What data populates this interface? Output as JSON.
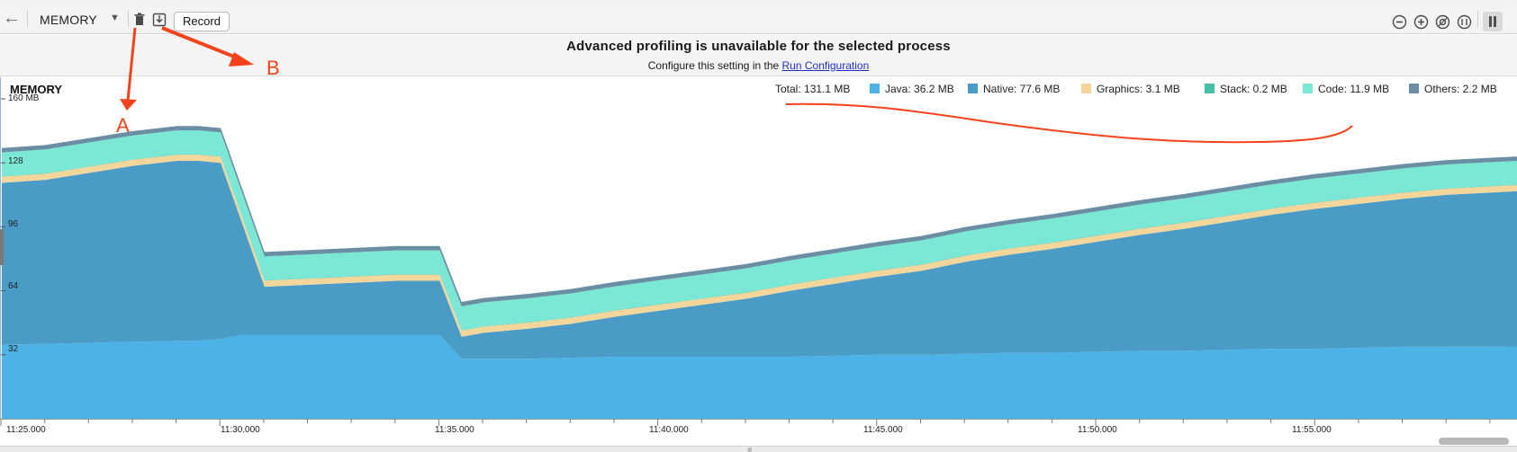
{
  "toolbar": {
    "profiler_name": "MEMORY",
    "record_label": "Record",
    "icons": [
      "back-arrow-icon",
      "chevron-down-icon",
      "trash-icon",
      "export-icon",
      "zoom-out-icon",
      "zoom-in-icon",
      "reset-zoom-icon",
      "fit-icon",
      "pause-icon"
    ]
  },
  "banner": {
    "title": "Advanced profiling is unavailable for the selected process",
    "subtitle_prefix": "Configure this setting in the ",
    "link_text": "Run Configuration"
  },
  "panel": {
    "title": "MEMORY",
    "total": "Total: 131.1 MB"
  },
  "annotations": {
    "a": "A",
    "b": "B"
  },
  "chart_data": {
    "type": "area",
    "stacked": true,
    "title": "MEMORY",
    "y_unit": "MB",
    "ylim": [
      0,
      160
    ],
    "y_ticks": [
      "160 MB",
      "128",
      "96",
      "64",
      "32"
    ],
    "y_tick_values": [
      160,
      128,
      96,
      64,
      32
    ],
    "x_tick_labels": [
      "11:25.000",
      "11:30.000",
      "11:35.000",
      "11:40.000",
      "11:45.000",
      "11:50.000",
      "11:55.000"
    ],
    "x_tick_minutes": [
      0,
      5,
      10,
      15,
      20,
      25,
      30
    ],
    "x_minutes": [
      0,
      1,
      2,
      3,
      4,
      4.5,
      5,
      5.5,
      6,
      7,
      8,
      9,
      10,
      10.5,
      11,
      12,
      13,
      14,
      15,
      16,
      17,
      18,
      19,
      20,
      21,
      22,
      23,
      24,
      25,
      26,
      27,
      28,
      29,
      30,
      31,
      32,
      33,
      34.6
    ],
    "xlim": [
      0,
      34.6
    ],
    "legend": [
      {
        "name": "Java",
        "label": "Java: 36.2 MB",
        "color": "#4bb3e6"
      },
      {
        "name": "Native",
        "label": "Native: 77.6 MB",
        "color": "#4a9bc6"
      },
      {
        "name": "Graphics",
        "label": "Graphics: 3.1 MB",
        "color": "#f2d69b"
      },
      {
        "name": "Stack",
        "label": "Stack: 0.2 MB",
        "color": "#45c0a8"
      },
      {
        "name": "Code",
        "label": "Code: 11.9 MB",
        "color": "#7ae8d4"
      },
      {
        "name": "Others",
        "label": "Others: 2.2 MB",
        "color": "#6a8fa4"
      }
    ],
    "series": [
      {
        "name": "Java",
        "values": [
          37,
          37.5,
          38,
          38.5,
          39,
          39,
          40,
          42,
          42,
          42,
          42,
          42,
          42,
          30,
          30,
          30,
          30.5,
          31,
          31,
          31,
          31,
          31,
          31.5,
          32,
          32,
          32.5,
          33,
          33,
          33.5,
          34,
          34,
          34.5,
          35,
          35,
          35.5,
          36,
          36,
          36.2
        ]
      },
      {
        "name": "Native",
        "values": [
          81,
          82,
          85,
          88,
          90,
          90,
          88,
          55,
          24,
          25,
          26,
          27,
          27,
          11,
          13,
          15,
          17,
          20,
          23,
          26,
          29,
          33,
          36,
          39,
          42,
          46,
          49,
          52,
          55,
          58,
          61,
          64,
          67,
          70,
          72,
          74,
          76,
          77.6
        ]
      },
      {
        "name": "Graphics",
        "values": [
          3.1,
          3.1,
          3.1,
          3.1,
          3.1,
          3.1,
          3.1,
          3.1,
          3.1,
          3.1,
          3.1,
          3.1,
          3.1,
          3.1,
          3.1,
          3.1,
          3.1,
          3.1,
          3.1,
          3.1,
          3.1,
          3.1,
          3.1,
          3.1,
          3.1,
          3.1,
          3.1,
          3.1,
          3.1,
          3.1,
          3.1,
          3.1,
          3.1,
          3.1,
          3.1,
          3.1,
          3.1,
          3.1
        ]
      },
      {
        "name": "Stack",
        "values": [
          0.2,
          0.2,
          0.2,
          0.2,
          0.2,
          0.2,
          0.2,
          0.2,
          0.2,
          0.2,
          0.2,
          0.2,
          0.2,
          0.2,
          0.2,
          0.2,
          0.2,
          0.2,
          0.2,
          0.2,
          0.2,
          0.2,
          0.2,
          0.2,
          0.2,
          0.2,
          0.2,
          0.2,
          0.2,
          0.2,
          0.2,
          0.2,
          0.2,
          0.2,
          0.2,
          0.2,
          0.2,
          0.2
        ]
      },
      {
        "name": "Code",
        "values": [
          11.9,
          11.9,
          11.9,
          11.9,
          11.9,
          11.9,
          11.9,
          11.9,
          11.9,
          11.9,
          11.9,
          11.9,
          11.9,
          11.9,
          11.9,
          11.9,
          11.9,
          11.9,
          11.9,
          11.9,
          11.9,
          11.9,
          11.9,
          11.9,
          11.9,
          11.9,
          11.9,
          11.9,
          11.9,
          11.9,
          11.9,
          11.9,
          11.9,
          11.9,
          11.9,
          11.9,
          11.9,
          11.9
        ]
      },
      {
        "name": "Others",
        "values": [
          2.2,
          2.2,
          2.2,
          2.2,
          2.2,
          2.2,
          2.2,
          2.2,
          2.2,
          2.2,
          2.2,
          2.2,
          2.2,
          2.2,
          2.2,
          2.2,
          2.2,
          2.2,
          2.2,
          2.2,
          2.2,
          2.2,
          2.2,
          2.2,
          2.2,
          2.2,
          2.2,
          2.2,
          2.2,
          2.2,
          2.2,
          2.2,
          2.2,
          2.2,
          2.2,
          2.2,
          2.2,
          2.2
        ]
      }
    ],
    "grid": false,
    "legend_position": "top-right"
  }
}
